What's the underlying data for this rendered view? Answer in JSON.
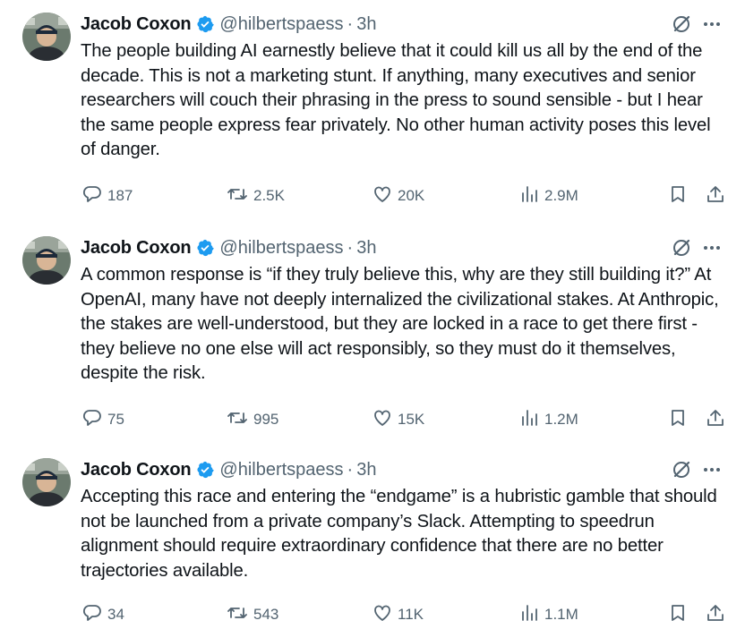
{
  "tweets": [
    {
      "author": "Jacob Coxon",
      "handle": "@hilbertspaess",
      "separator": "·",
      "time": "3h",
      "text": "The people building AI earnestly believe that it could kill us all by the end of the decade. This is not a marketing stunt. If anything, many executives and senior researchers will couch their phrasing in the press to sound sensible - but I hear the same people express fear privately. No other human activity poses this level of danger.",
      "replies": "187",
      "reposts": "2.5K",
      "likes": "20K",
      "views": "2.9M"
    },
    {
      "author": "Jacob Coxon",
      "handle": "@hilbertspaess",
      "separator": "·",
      "time": "3h",
      "text": "A common response is “if they truly believe this, why are they still building it?” At OpenAI, many have not deeply internalized the civilizational stakes. At Anthropic, the stakes are well-understood, but they are locked in a race to get there first - they believe no one else will act responsibly, so they must do it themselves, despite the risk.",
      "replies": "75",
      "reposts": "995",
      "likes": "15K",
      "views": "1.2M"
    },
    {
      "author": "Jacob Coxon",
      "handle": "@hilbertspaess",
      "separator": "·",
      "time": "3h",
      "text": "Accepting this race and entering the “endgame” is a hubristic gamble that should not be launched from a private company’s Slack. Attempting to speedrun alignment should require extraordinary confidence that there are no better trajectories available.",
      "replies": "34",
      "reposts": "543",
      "likes": "11K",
      "views": "1.1M"
    }
  ],
  "icons": {
    "verified": "verified-badge-icon",
    "grok": "grok-icon",
    "more": "more-icon",
    "reply": "reply-icon",
    "repost": "repost-icon",
    "like": "like-icon",
    "views": "views-icon",
    "bookmark": "bookmark-icon",
    "share": "share-icon"
  },
  "colors": {
    "text": "#0f1419",
    "secondary": "#536471",
    "verified": "#1d9bf0"
  }
}
